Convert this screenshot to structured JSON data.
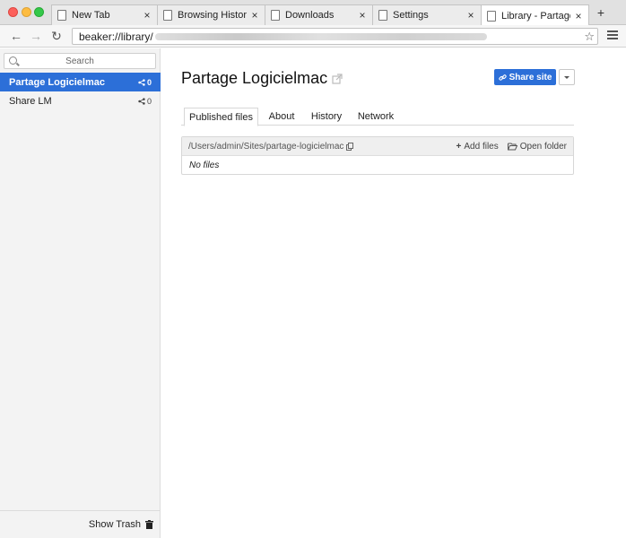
{
  "browser": {
    "tabs": [
      {
        "title": "New Tab"
      },
      {
        "title": "Browsing History"
      },
      {
        "title": "Downloads"
      },
      {
        "title": "Settings"
      },
      {
        "title": "Library - Partage Lo..."
      }
    ],
    "close_glyph": "×",
    "new_tab_glyph": "+",
    "url": "beaker://library/",
    "bookmark_glyph": "☆",
    "back_glyph": "←",
    "forward_glyph": "→",
    "reload_glyph": "↻"
  },
  "sidebar": {
    "search_placeholder": "Search",
    "items": [
      {
        "label": "Partage Logicielmac",
        "peers": "0",
        "active": true
      },
      {
        "label": "Share LM",
        "peers": "0",
        "active": false
      }
    ],
    "footer": {
      "trash_label": "Show Trash"
    }
  },
  "main": {
    "title": "Partage Logicielmac",
    "share_button": "Share site",
    "tabs": [
      {
        "label": "Published files",
        "active": true
      },
      {
        "label": "About"
      },
      {
        "label": "History"
      },
      {
        "label": "Network"
      }
    ],
    "files": {
      "path": "/Users/admin/Sites/partage-logicielmac",
      "add_files": "Add files",
      "open_folder": "Open folder",
      "empty_text": "No files"
    }
  },
  "colors": {
    "accent": "#2c6fd8"
  }
}
